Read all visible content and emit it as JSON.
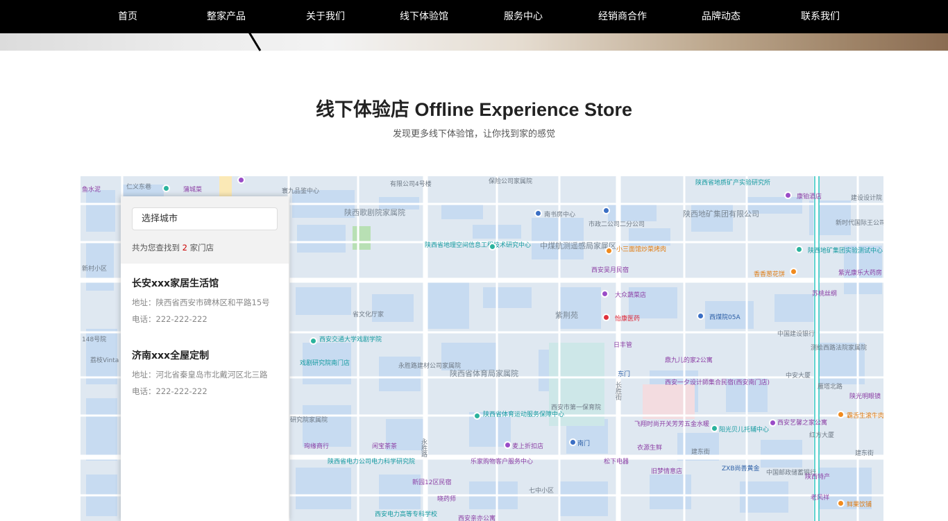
{
  "nav": {
    "items": [
      "首页",
      "整家产品",
      "关于我们",
      "线下体验馆",
      "服务中心",
      "经销商合作",
      "品牌动态",
      "联系我们"
    ]
  },
  "section": {
    "title": "线下体验店 Offline Experience Store",
    "subtitle": "发现更多线下体验馆，让你找到家的感觉"
  },
  "panel": {
    "city_placeholder": "选择城市",
    "count_prefix": "共为您查找到",
    "count": "2",
    "count_suffix": "家门店",
    "stores": [
      {
        "name": "长安xxx家居生活馆",
        "address": "地址：陕西省西安市碑林区和平路15号",
        "phone": "电话：222-222-222"
      },
      {
        "name": "济南xxx全屋定制",
        "address": "地址：河北省秦皇岛市北戴河区北三路",
        "phone": "电话：222-222-222"
      }
    ]
  },
  "map": {
    "labels": {
      "l1": "仁义东巷",
      "l2": "蒲城菜",
      "l3": "鱼水泥",
      "l4": "有限公司4号楼",
      "l5": "保险公司家属院",
      "l6": "陕西省地质矿产实验研究所",
      "l7": "康铂酒店",
      "l8": "建设设计院",
      "l9": "寰九品鉴中心",
      "l10": "陕西歌剧院家属院",
      "l11": "南书房中心",
      "l12": "市政二公司二分公司",
      "l13": "陕西地矿集团有限公司",
      "l14": "新时代国际王公司住宅小区",
      "l15": "陕西省地理空间信息工程技术研究中心",
      "l16": "中煤航测遥感局家属区",
      "l17": "小三面馆炒菜烤肉",
      "l18": "陕西地矿集团实验测试中心",
      "l19": "紫光康乐大药房",
      "l20": "新村小区",
      "l21": "西安吴月民宿",
      "l22": "香香葱花饼",
      "l23": "大众蔬菜店",
      "l24": "苏桃丝纲",
      "l25": "省文化厅家",
      "l26": "紫荆苑",
      "l27": "怡康医药",
      "l28": "西煤院05A",
      "l29": "中国建设银行",
      "l30": "148号院",
      "l31": "西安交通大学戏剧学院",
      "l32": "日丰管",
      "l33": "鼎九儿的家2公寓",
      "l34": "测绘西路法院家属院",
      "l35": "荔枝Vinta",
      "l36": "戏剧研究院南门店",
      "l37": "永胜路建材公司家属院",
      "l38": "陕西省体育局家属院",
      "l39": "东门",
      "l40": "西安一夕设计師集合民宿(西安南门店)",
      "l41": "中安大厦",
      "l42": "雁塔北路",
      "l43": "陕光明眼镜",
      "l44": "西安市第一保育院",
      "l45": "陕西省体育运动服务保障中心",
      "l46": "飞翔时尚开关芳芳五金水暖",
      "l47": "阳光贝儿托辅中心",
      "l48": "西安艺馨之家公寓",
      "l49": "霸舌生滚牛肉米粉",
      "l50": "研究院家属院",
      "l51": "珣缘商行",
      "l52": "闲宝茶茶",
      "l53": "麦上折扣店",
      "l54": "南门",
      "l55": "衣源生鲜",
      "l56": "红方大厦",
      "l57": "建东街",
      "l58": "陕西省电力公司电力科学研究院",
      "l59": "乐家购物客户服务中心",
      "l60": "松下电器",
      "l61": "旧梦情意店",
      "l62": "ZXB尚善黄金",
      "l63": "中国邮政储蓄银行",
      "l64": "陕西特产",
      "l65": "新园12区民宿",
      "l66": "晓药师",
      "l67": "七中小区",
      "l68": "老风祥",
      "l69": "鲜果饮铺",
      "l70": "西安电力高等专科学校",
      "l71": "西安亲亦公寓",
      "l72": "永胜路",
      "l73": "长胜街",
      "l74": "建东街"
    }
  }
}
